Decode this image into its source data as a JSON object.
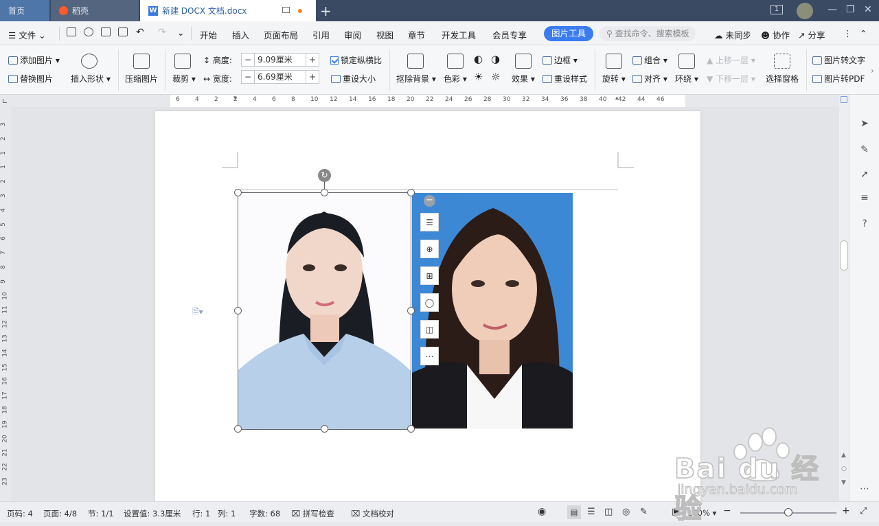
{
  "tabs": {
    "home": "首页",
    "daoke": "稻壳",
    "doc": "新建 DOCX 文档.docx"
  },
  "titlebar": {
    "page_indicator": "1"
  },
  "menu": {
    "file": "文件",
    "items": [
      "开始",
      "插入",
      "页面布局",
      "引用",
      "审阅",
      "视图",
      "章节",
      "开发工具",
      "会员专享"
    ],
    "picture_tools": "图片工具",
    "search_placeholder": "查找命令、搜索模板",
    "sync": "未同步",
    "collab": "协作",
    "share": "分享"
  },
  "ribbon": {
    "add_picture": "添加图片",
    "replace_picture": "替换图片",
    "insert_shape": "插入形状",
    "compress": "压缩图片",
    "crop": "裁剪",
    "height_label": "高度:",
    "height_value": "9.09厘米",
    "width_label": "宽度:",
    "width_value": "6.69厘米",
    "lock_ratio": "锁定纵横比",
    "reset_size": "重设大小",
    "remove_bg": "抠除背景",
    "color": "色彩",
    "effects": "效果",
    "border": "边框",
    "reset_style": "重设样式",
    "rotate": "旋转",
    "group": "组合",
    "align": "对齐",
    "wrap": "环绕",
    "bring_forward": "上移一层",
    "send_backward": "下移一层",
    "selection_pane": "选择窗格",
    "pic_to_text": "图片转文字",
    "pic_to_pdf": "图片转PDF"
  },
  "ruler": {
    "h_ticks": [
      "6",
      "4",
      "2",
      "2",
      "4",
      "6",
      "8",
      "10",
      "12",
      "14",
      "16",
      "18",
      "20",
      "22",
      "24",
      "26",
      "28",
      "30",
      "32",
      "34",
      "36",
      "38",
      "40",
      "42",
      "44",
      "46"
    ],
    "v_ticks": [
      "3",
      "2",
      "1",
      "1",
      "2",
      "3",
      "4",
      "5",
      "6",
      "7",
      "8",
      "9",
      "10",
      "11",
      "12",
      "13",
      "14",
      "15",
      "16",
      "17",
      "18",
      "19",
      "20",
      "21",
      "22",
      "23"
    ]
  },
  "statusbar": {
    "page_code": "页码: 4",
    "page": "页面: 4/8",
    "section": "节: 1/1",
    "setting": "设置值: 3.3厘米",
    "row": "行: 1",
    "col": "列: 1",
    "words": "字数: 68",
    "spell": "拼写检查",
    "proof": "文档校对",
    "zoom": "100%",
    "zoom_fraction": 0.5
  },
  "watermark": {
    "brand": "Bai du 经验",
    "url": "jingyan.baidu.com"
  },
  "colors": {
    "accent": "#3b7cf0",
    "titlebar": "#3a4a63",
    "photo2_bg": "#3d88d5"
  }
}
